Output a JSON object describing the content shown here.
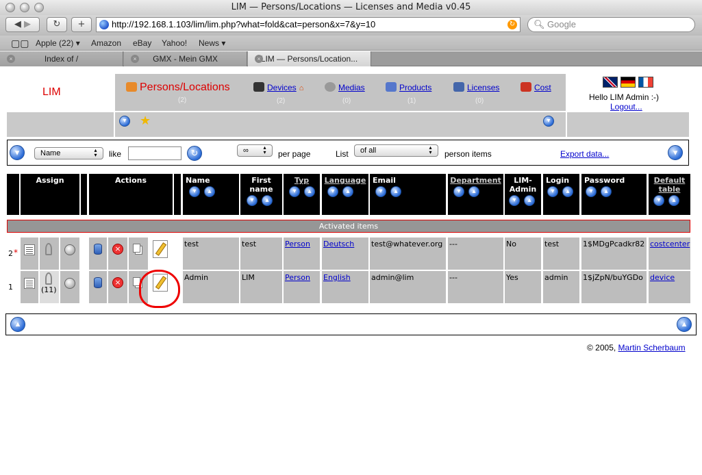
{
  "window": {
    "title": "LIM — Persons/Locations — Licenses and Media v0.45"
  },
  "toolbar": {
    "url": "http://192.168.1.103/lim/lim.php?what=fold&cat=person&x=7&y=10",
    "search_placeholder": "Google"
  },
  "bookmarks": [
    "Apple (22) ▾",
    "Amazon",
    "eBay",
    "Yahoo!",
    "News ▾"
  ],
  "tabs": [
    "Index of /",
    "GMX - Mein GMX",
    "LIM — Persons/Location..."
  ],
  "app": {
    "logo": "LIM",
    "nav": [
      {
        "label": "Persons/Locations",
        "count": "(2)",
        "icon": "persons-icon",
        "color": "#e88a2a"
      },
      {
        "label": "Devices",
        "count": "(2)",
        "icon": "monitor-icon",
        "color": "#333333"
      },
      {
        "label": "Medias",
        "count": "(0)",
        "icon": "cd-icon",
        "color": "#999999"
      },
      {
        "label": "Products",
        "count": "(1)",
        "icon": "products-icon",
        "color": "#5577cc"
      },
      {
        "label": "Licenses",
        "count": "(0)",
        "icon": "licenses-icon",
        "color": "#4466aa"
      },
      {
        "label": "Cost",
        "count": "",
        "icon": "cost-icon",
        "color": "#cc3322"
      }
    ],
    "greeting": "Hello LIM Admin :-)",
    "logout": "Logout..."
  },
  "filter": {
    "field": "Name",
    "like": "like",
    "per_page_value": "∞",
    "per_page": "per page",
    "list": "List",
    "list_value": "of all",
    "items": "person items",
    "export": "Export data..."
  },
  "table": {
    "headers": {
      "assign": "Assign",
      "actions": "Actions",
      "name": "Name",
      "first_name_1": "First",
      "first_name_2": "name",
      "typ": "Typ",
      "language": "Language",
      "email": "Email",
      "department": "Department",
      "lim_admin_1": "LIM-",
      "lim_admin_2": "Admin",
      "login": "Login",
      "password": "Password",
      "default_table_1": "Default",
      "default_table_2": "table"
    },
    "section": "Activated items",
    "rows": [
      {
        "num": "2",
        "star": "*",
        "assign_count": "",
        "name": "test",
        "first": "test",
        "typ": "Person",
        "language": "Deutsch",
        "email": "test@whatever.org",
        "department": "---",
        "admin": "No",
        "login": "test",
        "password": "1$MDgPcadkr82",
        "default": "costcenter"
      },
      {
        "num": "1",
        "star": "",
        "assign_count": "(11)",
        "name": "Admin",
        "first": "LIM",
        "typ": "Person",
        "language": "English",
        "email": "admin@lim",
        "department": "---",
        "admin": "Yes",
        "login": "admin",
        "password": "1$jZpN/buYGDo",
        "default": "device"
      }
    ]
  },
  "footer": {
    "copyright": "© 2005, ",
    "author": "Martin Scherbaum"
  },
  "colors": {
    "accent": "#dd0000",
    "link": "#0000cc",
    "nav_bg": "#c4c4c4",
    "header_bg": "#000000",
    "row_bg": "#bdbdbd"
  }
}
